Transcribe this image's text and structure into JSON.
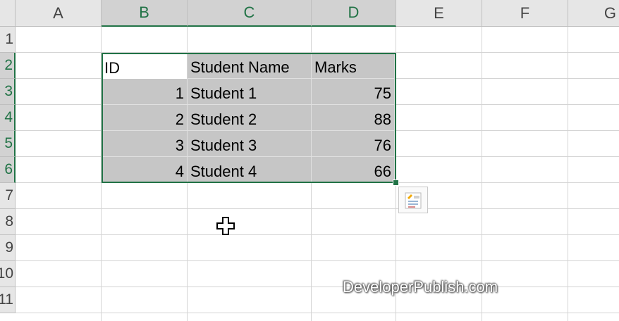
{
  "columns": [
    "A",
    "B",
    "C",
    "D",
    "E",
    "F",
    "G"
  ],
  "rows": [
    "1",
    "2",
    "3",
    "4",
    "5",
    "6",
    "7",
    "8",
    "9",
    "10",
    "11"
  ],
  "table": {
    "headers": [
      "ID",
      "Student Name",
      "Marks"
    ],
    "records": [
      {
        "id": "1",
        "name": "Student 1",
        "marks": "75"
      },
      {
        "id": "2",
        "name": "Student 2",
        "marks": "88"
      },
      {
        "id": "3",
        "name": "Student 3",
        "marks": "76"
      },
      {
        "id": "4",
        "name": "Student 4",
        "marks": "66"
      }
    ]
  },
  "quick_analysis_icon": "quick-analysis-icon",
  "cursor_icon": "cell-select-cursor-icon",
  "watermark": "DeveloperPublish.com",
  "colors": {
    "selection": "#217346",
    "header_bg": "#e6e6e6",
    "selected_header_bg": "#d2d2d2",
    "shaded_cell": "#c6c6c6"
  }
}
